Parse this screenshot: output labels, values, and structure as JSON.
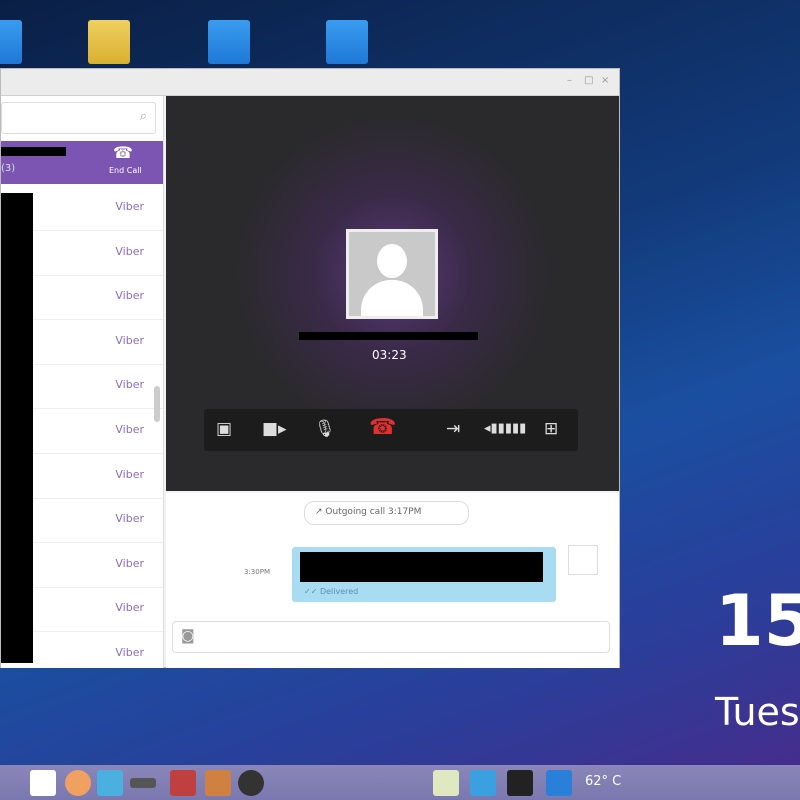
{
  "window": {
    "minimize": "–",
    "maximize": "□",
    "close": "×"
  },
  "sidebar": {
    "search_placeholder": "",
    "end_call_label": "End Call",
    "active_sub": "(3)",
    "items": [
      "Viber",
      "Viber",
      "Viber",
      "Viber",
      "Viber",
      "Viber",
      "Viber",
      "Viber",
      "Viber",
      "Viber",
      "Viber"
    ]
  },
  "call": {
    "timer": "03:23"
  },
  "chat": {
    "outgoing": "↗ Outgoing call   3:17PM",
    "msg_time": "3:30PM",
    "msg_status": "✓✓ Delivered"
  },
  "clock": {
    "time": "15",
    "day": "Tues"
  },
  "taskbar": {
    "temp": "62° C"
  }
}
